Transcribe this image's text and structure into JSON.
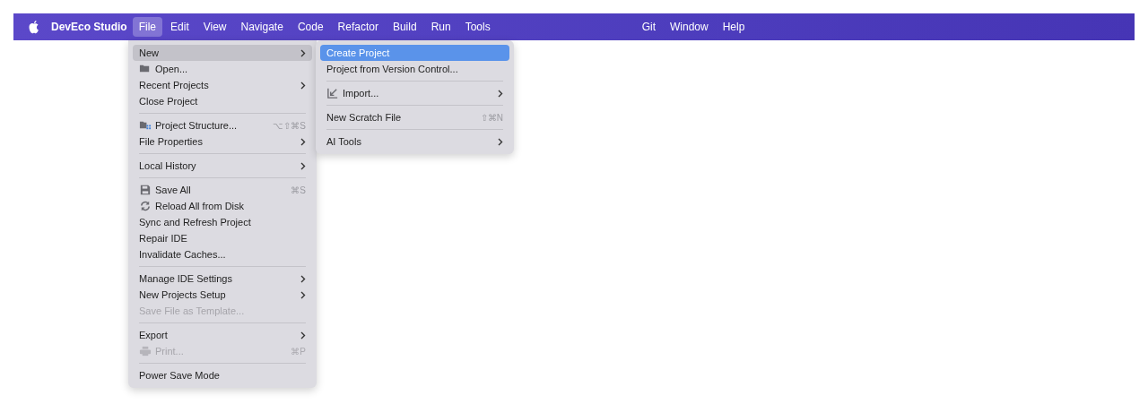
{
  "menu_bar": {
    "app_name": "DevEco Studio",
    "menus": [
      {
        "label": "File",
        "selected": true
      },
      {
        "label": "Edit",
        "selected": false
      },
      {
        "label": "View",
        "selected": false
      },
      {
        "label": "Navigate",
        "selected": false
      },
      {
        "label": "Code",
        "selected": false
      },
      {
        "label": "Refactor",
        "selected": false
      },
      {
        "label": "Build",
        "selected": false
      },
      {
        "label": "Run",
        "selected": false
      },
      {
        "label": "Tools",
        "selected": false
      }
    ],
    "right_menus": [
      {
        "label": "Git",
        "selected": false
      },
      {
        "label": "Window",
        "selected": false
      },
      {
        "label": "Help",
        "selected": false
      }
    ]
  },
  "file_menu": {
    "items": [
      {
        "kind": "item",
        "label": "New",
        "submenu": true,
        "selected": true,
        "disabled": false
      },
      {
        "kind": "item",
        "label": "Open...",
        "selected": false,
        "disabled": false
      },
      {
        "kind": "item",
        "label": "Recent Projects",
        "submenu": true,
        "selected": false,
        "disabled": false
      },
      {
        "kind": "item",
        "label": "Close Project",
        "selected": false,
        "disabled": false
      },
      {
        "kind": "separator"
      },
      {
        "kind": "item",
        "label": "Project Structure...",
        "shortcut": "⌥⇧⌘S",
        "selected": false,
        "disabled": false
      },
      {
        "kind": "item",
        "label": "File Properties",
        "submenu": true,
        "selected": false,
        "disabled": false
      },
      {
        "kind": "separator"
      },
      {
        "kind": "item",
        "label": "Local History",
        "submenu": true,
        "selected": false,
        "disabled": false
      },
      {
        "kind": "separator"
      },
      {
        "kind": "item",
        "label": "Save All",
        "shortcut": "⌘S",
        "selected": false,
        "disabled": false
      },
      {
        "kind": "item",
        "label": "Reload All from Disk",
        "selected": false,
        "disabled": false
      },
      {
        "kind": "item",
        "label": "Sync and Refresh Project",
        "selected": false,
        "disabled": false
      },
      {
        "kind": "item",
        "label": "Repair IDE",
        "selected": false,
        "disabled": false
      },
      {
        "kind": "item",
        "label": "Invalidate Caches...",
        "selected": false,
        "disabled": false
      },
      {
        "kind": "separator"
      },
      {
        "kind": "item",
        "label": "Manage IDE Settings",
        "submenu": true,
        "selected": false,
        "disabled": false
      },
      {
        "kind": "item",
        "label": "New Projects Setup",
        "submenu": true,
        "selected": false,
        "disabled": false
      },
      {
        "kind": "item",
        "label": "Save File as Template...",
        "selected": false,
        "disabled": true
      },
      {
        "kind": "separator"
      },
      {
        "kind": "item",
        "label": "Export",
        "submenu": true,
        "selected": false,
        "disabled": false
      },
      {
        "kind": "item",
        "label": "Print...",
        "shortcut": "⌘P",
        "selected": false,
        "disabled": true
      },
      {
        "kind": "separator"
      },
      {
        "kind": "item",
        "label": "Power Save Mode",
        "selected": false,
        "disabled": false
      }
    ]
  },
  "new_submenu": {
    "items": [
      {
        "kind": "item",
        "label": "Create Project",
        "selected": true,
        "disabled": false
      },
      {
        "kind": "item",
        "label": "Project from Version Control...",
        "selected": false,
        "disabled": false
      },
      {
        "kind": "separator"
      },
      {
        "kind": "item",
        "label": "Import...",
        "submenu": true,
        "selected": false,
        "disabled": false
      },
      {
        "kind": "separator"
      },
      {
        "kind": "item",
        "label": "New Scratch File",
        "shortcut": "⇧⌘N",
        "selected": false,
        "disabled": false
      },
      {
        "kind": "separator"
      },
      {
        "kind": "item",
        "label": "AI Tools",
        "submenu": true,
        "selected": false,
        "disabled": false
      }
    ]
  }
}
